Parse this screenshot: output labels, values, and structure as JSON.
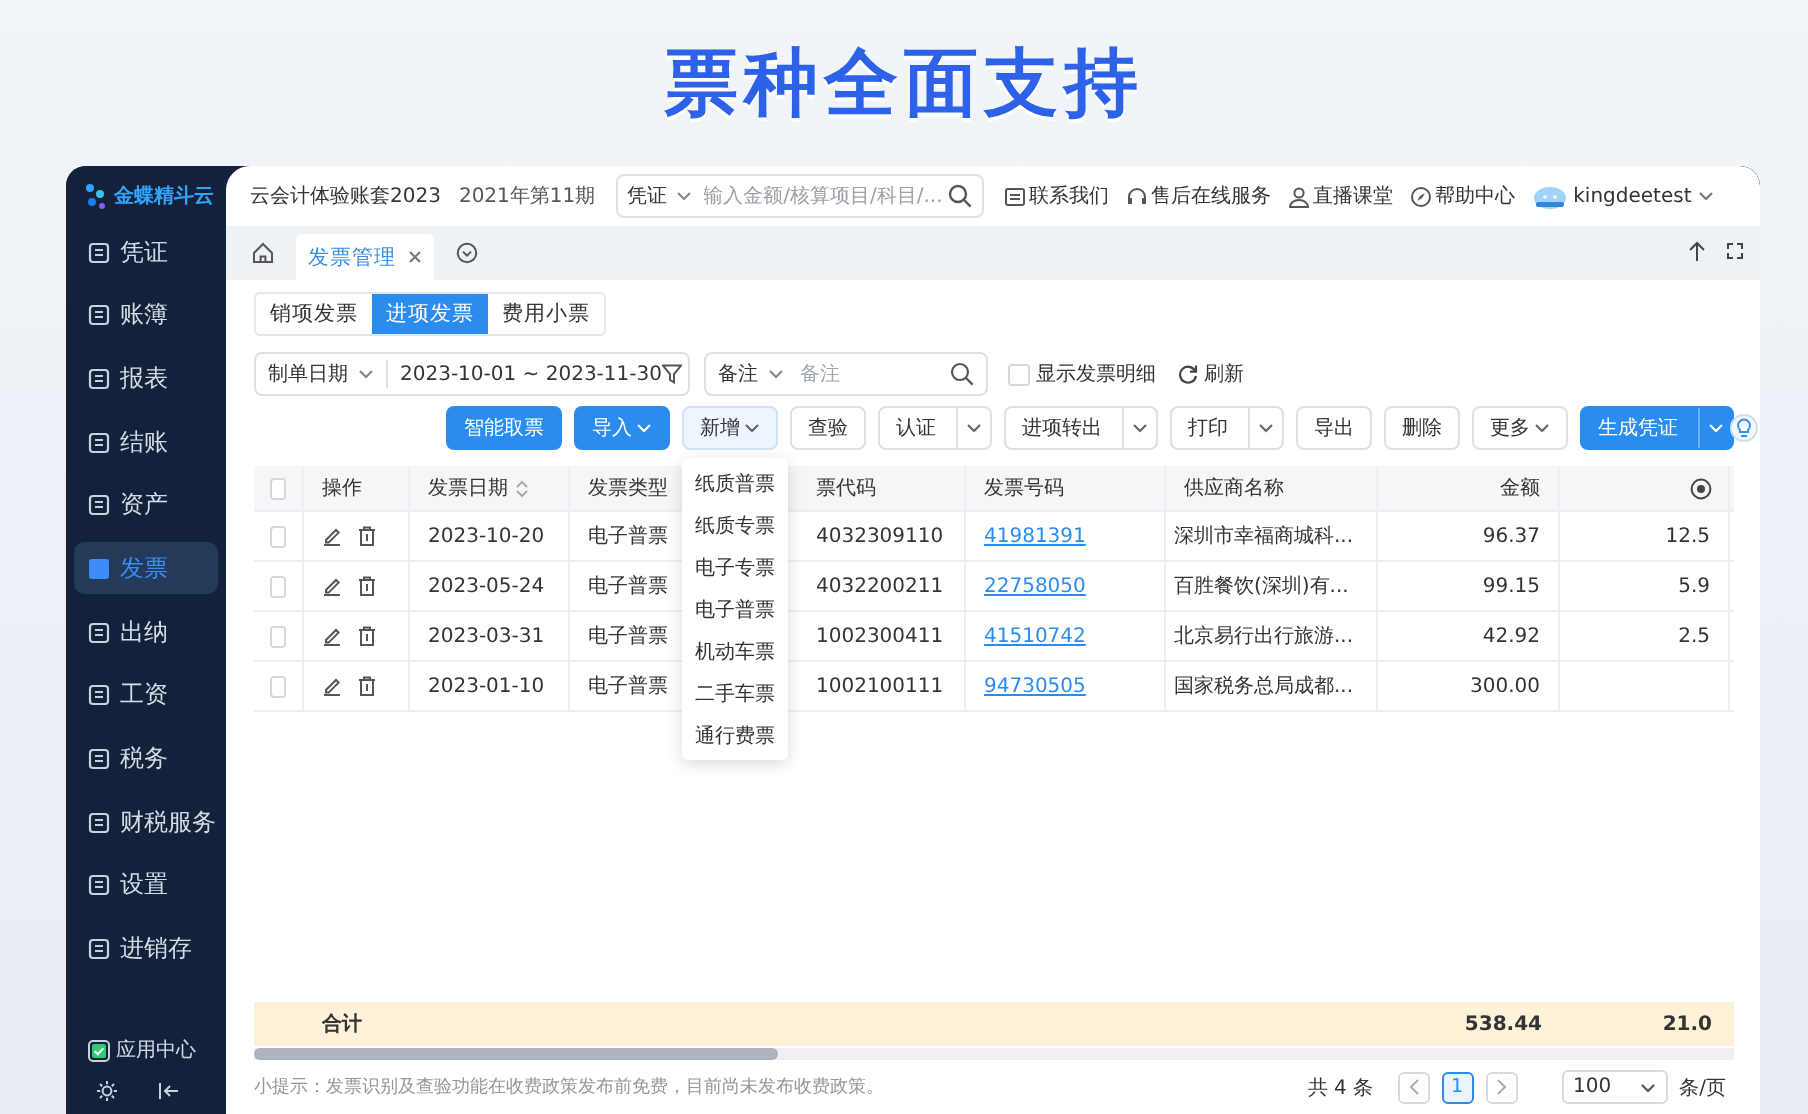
{
  "headline": "票种全面支持",
  "sidebar": {
    "logo": "金蝶精斗云",
    "items": [
      {
        "label": "凭证",
        "selected": false
      },
      {
        "label": "账簿",
        "selected": false
      },
      {
        "label": "报表",
        "selected": false
      },
      {
        "label": "结账",
        "selected": false
      },
      {
        "label": "资产",
        "selected": false
      },
      {
        "label": "发票",
        "selected": true
      },
      {
        "label": "出纳",
        "selected": false
      },
      {
        "label": "工资",
        "selected": false
      },
      {
        "label": "税务",
        "selected": false
      },
      {
        "label": "财税服务",
        "selected": false
      },
      {
        "label": "设置",
        "selected": false
      },
      {
        "label": "进销存",
        "selected": false
      }
    ],
    "app_center": "应用中心"
  },
  "topbar": {
    "account": "云会计体验账套2023",
    "period": "2021年第11期",
    "search": {
      "scope": "凭证",
      "placeholder": "输入金额/核算项目/科目/..."
    },
    "links": [
      "联系我们",
      "售后在线服务",
      "直播课堂",
      "帮助中心"
    ],
    "user": "kingdeetest"
  },
  "page_tabs": [
    {
      "label": "发票管理",
      "selected": true
    }
  ],
  "invoice_tabs": [
    {
      "label": "销项发票",
      "selected": false
    },
    {
      "label": "进项发票",
      "selected": true
    },
    {
      "label": "费用小票",
      "selected": false
    }
  ],
  "filters": {
    "date_field": "制单日期",
    "date_range": "2023-10-01 ~ 2023-11-30",
    "remark_field": "备注",
    "remark_placeholder": "备注",
    "show_details": {
      "label": "显示发票明细",
      "checked": false
    },
    "refresh": "刷新"
  },
  "toolbar": [
    {
      "label": "智能取票",
      "kind": "primary"
    },
    {
      "label": "导入",
      "kind": "primary-dropdown"
    },
    {
      "label": "新增",
      "kind": "dropdown-open"
    },
    {
      "label": "查验",
      "kind": "plain"
    },
    {
      "label": "认证",
      "kind": "split"
    },
    {
      "label": "进项转出",
      "kind": "split"
    },
    {
      "label": "打印",
      "kind": "split"
    },
    {
      "label": "导出",
      "kind": "plain"
    },
    {
      "label": "删除",
      "kind": "plain"
    },
    {
      "label": "更多",
      "kind": "dropdown"
    },
    {
      "label": "生成凭证",
      "kind": "primary-split"
    }
  ],
  "new_menu": [
    "纸质普票",
    "纸质专票",
    "电子专票",
    "电子普票",
    "机动车票",
    "二手车票",
    "通行费票"
  ],
  "table": {
    "select_all": {
      "checked": false
    },
    "columns": [
      {
        "label": "操作",
        "sortable": false
      },
      {
        "label": "发票日期",
        "sortable": true
      },
      {
        "label": "发票类型",
        "sortable": false
      },
      {
        "label": "票代码",
        "sortable": false
      },
      {
        "label": "发票号码",
        "sortable": false
      },
      {
        "label": "供应商名称",
        "sortable": false
      },
      {
        "label": "金额",
        "sortable": false
      }
    ],
    "rows": [
      {
        "checked": false,
        "date": "2023-10-20",
        "type": "电子普票",
        "code": "4032309110",
        "number": "41981391",
        "supplier": "深圳市幸福商城科...",
        "amount": "96.37",
        "column_9": "12.5"
      },
      {
        "checked": false,
        "date": "2023-05-24",
        "type": "电子普票",
        "code": "4032200211",
        "number": "22758050",
        "supplier": "百胜餐饮(深圳)有...",
        "amount": "99.15",
        "column_9": "5.9"
      },
      {
        "checked": false,
        "date": "2023-03-31",
        "type": "电子普票",
        "code": "1002300411",
        "number": "41510742",
        "supplier": "北京易行出行旅游...",
        "amount": "42.92",
        "column_9": "2.5"
      },
      {
        "checked": false,
        "date": "2023-01-10",
        "type": "电子普票",
        "code": "1002100111",
        "number": "94730505",
        "supplier": "国家税务总局成都...",
        "amount": "300.00"
      }
    ],
    "total": {
      "label": "合计",
      "amount": "538.44",
      "column_9": "21.0"
    }
  },
  "footer": {
    "tip": "小提示：发票识别及查验功能在收费政策发布前免费，目前尚未发布收费政策。",
    "count": "共 4 条",
    "pages": [
      {
        "label": "1",
        "selected": true
      }
    ],
    "page_size": "100",
    "per_page": "条/页"
  }
}
